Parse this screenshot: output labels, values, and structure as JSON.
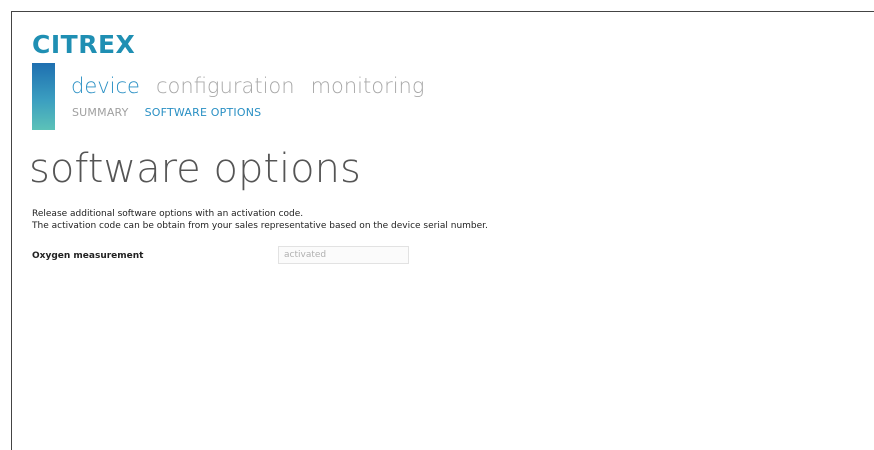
{
  "brand": {
    "logo_text": "CITREX"
  },
  "nav": {
    "main": [
      {
        "label": "device",
        "active": true
      },
      {
        "label": "configuration",
        "active": false
      },
      {
        "label": "monitoring",
        "active": false
      }
    ],
    "sub": [
      {
        "label": "SUMMARY",
        "active": false
      },
      {
        "label": "SOFTWARE OPTIONS",
        "active": true
      }
    ]
  },
  "page": {
    "title": "software options",
    "description_lines": [
      "Release additional software options with an activation code.",
      "The activation code can be obtain from your sales representative based on the device serial number."
    ]
  },
  "options": [
    {
      "label": "Oxygen measurement",
      "value": "activated"
    }
  ],
  "colors": {
    "brand": "#1f8fb3",
    "active_nav": "#2a90c4",
    "inactive_nav": "#a8a8a8"
  }
}
